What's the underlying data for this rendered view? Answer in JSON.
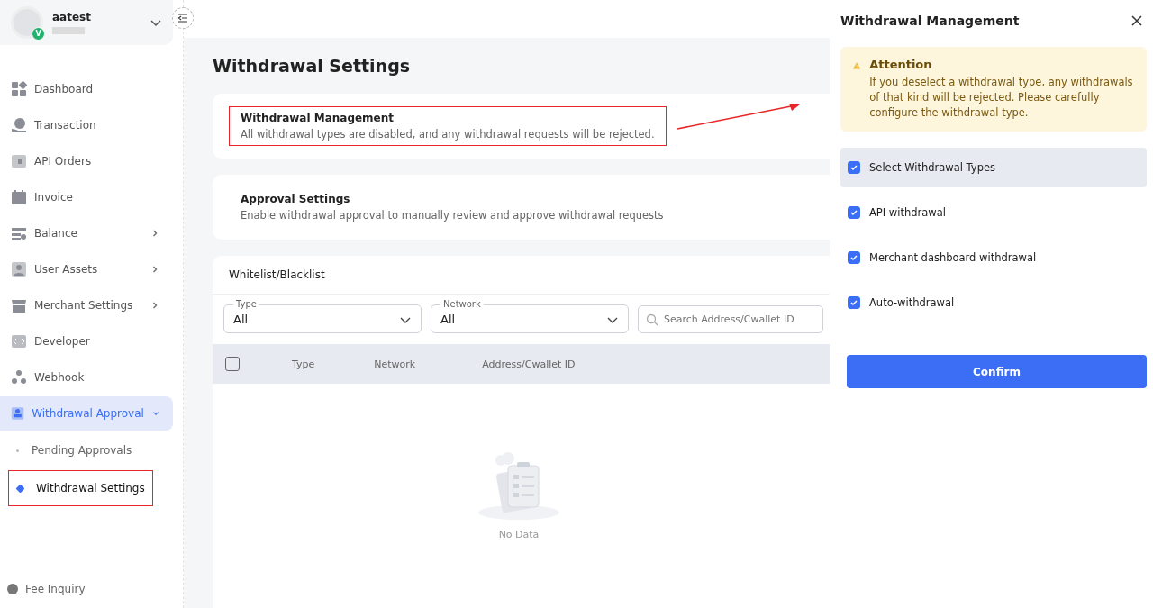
{
  "user": {
    "name": "aatest",
    "badge": "V"
  },
  "nav": [
    {
      "label": "Dashboard",
      "selected": false
    },
    {
      "label": "Transaction",
      "selected": false
    },
    {
      "label": "API Orders",
      "selected": false
    },
    {
      "label": "Invoice",
      "selected": false
    },
    {
      "label": "Balance",
      "expanded": false,
      "selected": false
    },
    {
      "label": "User Assets",
      "expanded": false,
      "selected": false
    },
    {
      "label": "Merchant Settings",
      "expanded": false,
      "selected": false
    },
    {
      "label": "Developer",
      "selected": false
    },
    {
      "label": "Webhook",
      "selected": false
    },
    {
      "label": "Withdrawal Approval",
      "expanded": true,
      "selected": true,
      "children": [
        {
          "label": "Pending Approvals",
          "selected": false,
          "highlighted": false
        },
        {
          "label": "Withdrawal Settings",
          "selected": true,
          "highlighted": true
        }
      ]
    }
  ],
  "footer": {
    "label": "Fee Inquiry"
  },
  "page_title": "Withdrawal Settings",
  "cards": [
    {
      "title": "Withdrawal Management",
      "description": "All withdrawal types are disabled, and any withdrawal requests will be rejected.",
      "highlighted": true
    },
    {
      "title": "Approval Settings",
      "description": "Enable withdrawal approval to manually review and approve withdrawal requests",
      "highlighted": false
    }
  ],
  "list": {
    "title": "Whitelist/Blacklist",
    "filters": [
      {
        "label": "Type",
        "value": "All"
      },
      {
        "label": "Network",
        "value": "All"
      }
    ],
    "search": {
      "placeholder": "Search Address/Cwallet ID"
    },
    "select_all": {
      "checked": false
    },
    "columns": [
      "Type",
      "Network",
      "Address/Cwallet ID"
    ],
    "empty": "No Data"
  },
  "drawer": {
    "title": "Withdrawal Management",
    "alert": {
      "title": "Attention",
      "text": "If you deselect a withdrawal type, any withdrawals of that kind will be rejected. Please carefully configure the withdrawal type."
    },
    "options": [
      {
        "kind": "all",
        "label": "Select Withdrawal Types",
        "checked": true
      },
      {
        "kind": "option",
        "label": "API withdrawal",
        "checked": true
      },
      {
        "kind": "option",
        "label": "Merchant dashboard withdrawal",
        "checked": true
      },
      {
        "kind": "option",
        "label": "Auto-withdrawal",
        "checked": true
      }
    ],
    "confirm": "Confirm"
  }
}
